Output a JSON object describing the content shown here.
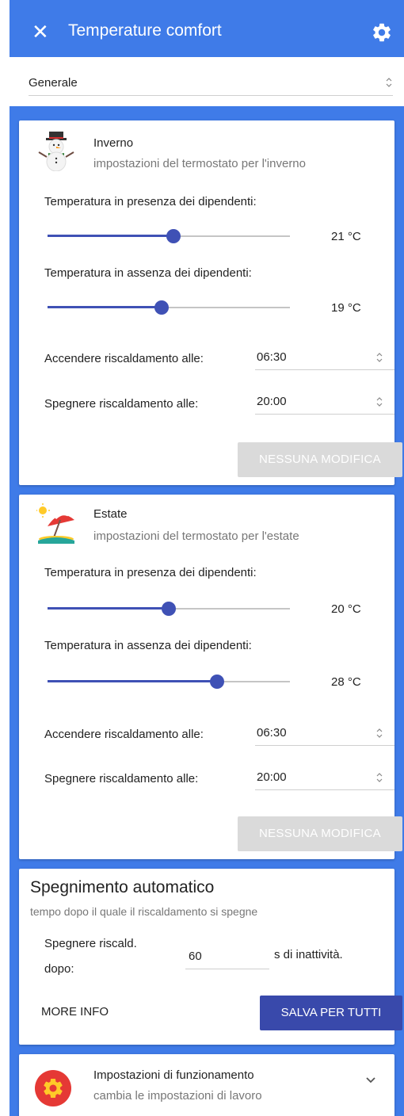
{
  "header": {
    "title": "Temperature comfort",
    "close_icon": "close-icon",
    "settings_icon": "gear-icon"
  },
  "section_select": {
    "value": "Generale"
  },
  "winter": {
    "title": "Inverno",
    "subtitle": "impostazioni del termostato per l'inverno",
    "icon": "snowman-icon",
    "presence_label": "Temperatura in presenza dei dipendenti:",
    "presence_value": "21 °C",
    "presence_level": 0.52,
    "absence_label": "Temperatura in assenza dei dipendenti:",
    "absence_value": "19 °C",
    "absence_level": 0.47,
    "on_label": "Accendere riscaldamento alle:",
    "on_value": "06:30",
    "off_label": "Spegnere riscaldamento alle:",
    "off_value": "20:00",
    "button_label": "NESSUNA MODIFICA"
  },
  "summer": {
    "title": "Estate",
    "subtitle": "impostazioni del termostato per l'estate",
    "icon": "beach-umbrella-icon",
    "presence_label": "Temperatura in presenza dei dipendenti:",
    "presence_value": "20 °C",
    "presence_level": 0.5,
    "absence_label": "Temperatura in assenza dei dipendenti:",
    "absence_value": "28 °C",
    "absence_level": 0.7,
    "on_label": "Accendere riscaldamento alle:",
    "on_value": "06:30",
    "off_label": "Spegnere riscaldamento alle:",
    "off_value": "20:00",
    "button_label": "NESSUNA MODIFICA"
  },
  "auto_off": {
    "title": "Spegnimento automatico",
    "subtitle": "tempo dopo il quale il riscaldamento si spegne",
    "label_line1": "Spegnere riscald.",
    "label_line2": "dopo:",
    "value": "60",
    "suffix": "s di inattività.",
    "more_info_label": "MORE INFO",
    "save_label": "SALVA PER TUTTI"
  },
  "operation": {
    "title": "Impostazioni di funzionamento",
    "subtitle": "cambia le impostazioni di lavoro",
    "icon": "gear-icon",
    "expand_icon": "chevron-down-icon"
  },
  "colors": {
    "accent": "#3f7be8",
    "primary": "#3f51b5",
    "operation_icon_bg": "#e53935"
  }
}
